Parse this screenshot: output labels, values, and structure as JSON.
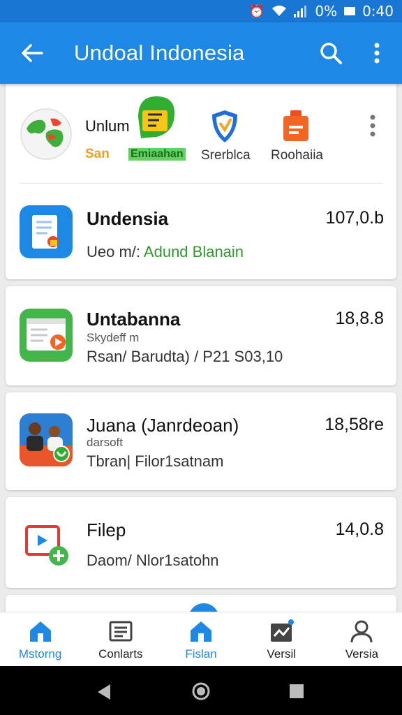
{
  "status_bar": {
    "battery_text": "0%",
    "time": "0:40"
  },
  "app_bar": {
    "title": "Undoal Indonesia"
  },
  "top_card": {
    "chips": [
      {
        "line1": "Unlum",
        "line2": "San",
        "line2_color": "#f0a020"
      },
      {
        "line1": "",
        "line2": "Emiaahan",
        "line2_color": "#2e9a2e"
      },
      {
        "line1": "",
        "line2": "Srerblca",
        "line2_color": "#333333"
      },
      {
        "line1": "",
        "line2": "Roohaiia",
        "line2_color": "#333333"
      }
    ]
  },
  "apps": [
    {
      "name": "Undensia",
      "size": "107,0.b",
      "sub_prefix": "Ueo m/: ",
      "sub_highlight": "Adund Blanain",
      "tiny": "",
      "icon": "document-icon"
    },
    {
      "name": "Untabanna",
      "size": "18,8.8",
      "sub_prefix": "Rsan/ Barudta) / P21 S03,10",
      "sub_highlight": "",
      "tiny": "Skydeff m",
      "icon": "video-player-icon"
    },
    {
      "name": "Juana (Janrdeoan)",
      "size": "18,58re",
      "sub_prefix": "Tbran| Filor1satnam",
      "sub_highlight": "",
      "tiny": "darsoft",
      "icon": "people-photo-icon"
    },
    {
      "name": "Filep",
      "size": "14,0.8",
      "sub_prefix": "Daom/ Nlor1satohn",
      "sub_highlight": "",
      "tiny": "",
      "icon": "video-add-icon"
    }
  ],
  "bottom_nav": [
    {
      "label": "Mstorng",
      "icon": "home-icon",
      "active": true
    },
    {
      "label": "Conlarts",
      "icon": "list-icon",
      "active": false
    },
    {
      "label": "Fislan",
      "icon": "home-icon",
      "active": true
    },
    {
      "label": "Versil",
      "icon": "inbox-chart-icon",
      "active": false
    },
    {
      "label": "Versia",
      "icon": "person-icon",
      "active": false
    }
  ],
  "colors": {
    "primary": "#1e88e5",
    "status": "#1976d2",
    "accent_green": "#2e9a2e"
  }
}
